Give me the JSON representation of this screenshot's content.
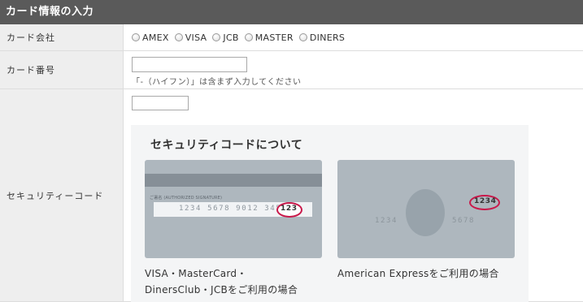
{
  "header": {
    "title": "カード情報の入力"
  },
  "rows": {
    "company": {
      "label": "カード会社",
      "options": [
        "AMEX",
        "VISA",
        "JCB",
        "MASTER",
        "DINERS"
      ]
    },
    "number": {
      "label": "カード番号",
      "value": "",
      "hint": "「-（ハイフン）」は含まず入力してください"
    },
    "security": {
      "label": "セキュリティーコード",
      "value": "",
      "info": {
        "title": "セキュリティコードについて",
        "back_card": {
          "signature_label": "ご署名 (AUTHORIZED SIGNATURE)",
          "card_number": "1234 5678 9012 3456",
          "code": "123",
          "caption_line1": "VISA・MasterCard・",
          "caption_line2": "DinersClub・JCBをご利用の場合"
        },
        "front_card": {
          "number_left": "1234",
          "number_right": "5678",
          "code": "1234",
          "caption": "American Expressをご利用の場合"
        }
      }
    }
  },
  "colors": {
    "header_bg": "#5a5a5a",
    "label_bg": "#eeeeee",
    "card_bg": "#aeb7be",
    "highlight": "#c9184a"
  }
}
